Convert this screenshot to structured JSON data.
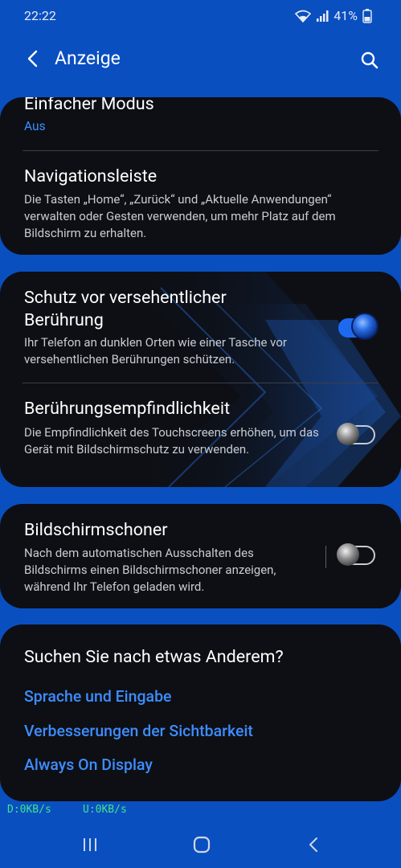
{
  "status_bar": {
    "time": "22:22",
    "battery_percent": "41%",
    "icons": [
      "wifi-icon",
      "signal-icon",
      "battery-icon"
    ]
  },
  "app_bar": {
    "title": "Anzeige",
    "back_icon": "chevron-left-icon",
    "search_icon": "search-icon"
  },
  "card1": {
    "easy_mode": {
      "title": "Einfacher Modus",
      "value": "Aus"
    },
    "navigation_bar": {
      "title": "Navigationsleiste",
      "description": "Die Tasten „Home“, „Zurück“ und „Aktuelle Anwendungen“ verwalten oder Gesten verwenden, um mehr Platz auf dem Bildschirm zu erhalten."
    }
  },
  "card2": {
    "accidental_touch": {
      "title": "Schutz vor versehentlicher Berührung",
      "description": "Ihr Telefon an dunklen Orten wie einer Tasche vor versehentlichen Berührungen schützen.",
      "enabled": true
    },
    "touch_sensitivity": {
      "title": "Berührungsempfindlichkeit",
      "description": "Die Empfindlichkeit des Touchscreens erhöhen, um das Gerät mit Bildschirmschutz zu verwenden.",
      "enabled": false
    }
  },
  "card3": {
    "screensaver": {
      "title": "Bildschirmschoner",
      "description": "Nach dem automatischen Ausschalten des Bildschirms einen Bildschirmschoner anzeigen, während Ihr Telefon geladen wird.",
      "enabled": false
    }
  },
  "suggestions": {
    "heading": "Suchen Sie nach etwas Anderem?",
    "links": [
      "Sprache und Eingabe",
      "Verbesserungen der Sichtbarkeit",
      "Always On Display"
    ]
  },
  "network_meter": {
    "download": "D:0KB/s",
    "upload": "U:0KB/s"
  },
  "nav_bar": {
    "icons": [
      "recent-apps-icon",
      "home-icon",
      "back-icon"
    ]
  },
  "colors": {
    "background": "#0a4fc0",
    "card": "#0d0f14",
    "accent": "#3e8dff",
    "toggle_on": "#1d6af0",
    "net_meter": "#3fe38a"
  }
}
